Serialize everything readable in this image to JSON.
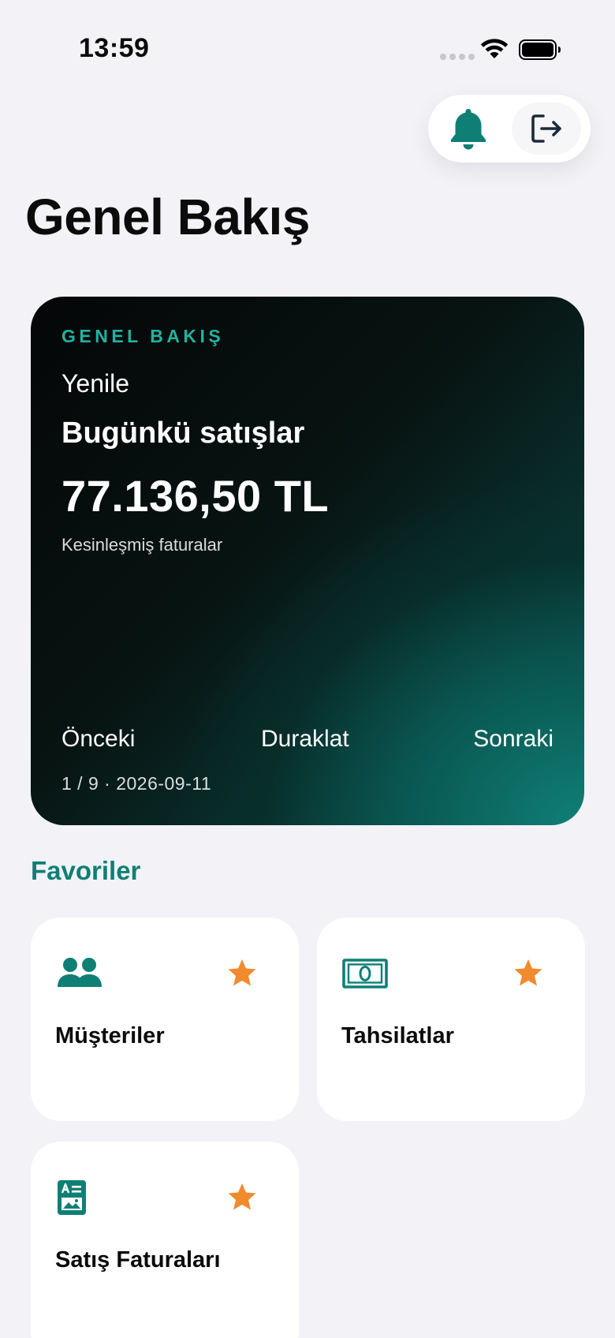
{
  "status_bar": {
    "time": "13:59"
  },
  "header": {
    "title": "Genel Bakış",
    "actions": [
      {
        "icon": "bell-icon",
        "color": "#0f7f76"
      },
      {
        "icon": "logout-icon",
        "color": "#1c2a3a"
      }
    ]
  },
  "hero": {
    "eyebrow": "GENEL BAKIŞ",
    "refresh_label": "Yenile",
    "subtitle": "Bugünkü satışlar",
    "amount": "77.136,50 TL",
    "note": "Kesinleşmiş faturalar",
    "prev_label": "Önceki",
    "pause_label": "Duraklat",
    "next_label": "Sonraki",
    "pager": "1 / 9 · 2026-09-11",
    "accent_color": "#20b3a0"
  },
  "favorites": {
    "title": "Favoriler",
    "star_color": "#f28a2e",
    "items": [
      {
        "label": "Müşteriler",
        "icon": "people-icon"
      },
      {
        "label": "Tahsilatlar",
        "icon": "banknote-icon"
      },
      {
        "label": "Satış Faturaları",
        "icon": "invoice-icon"
      }
    ]
  }
}
